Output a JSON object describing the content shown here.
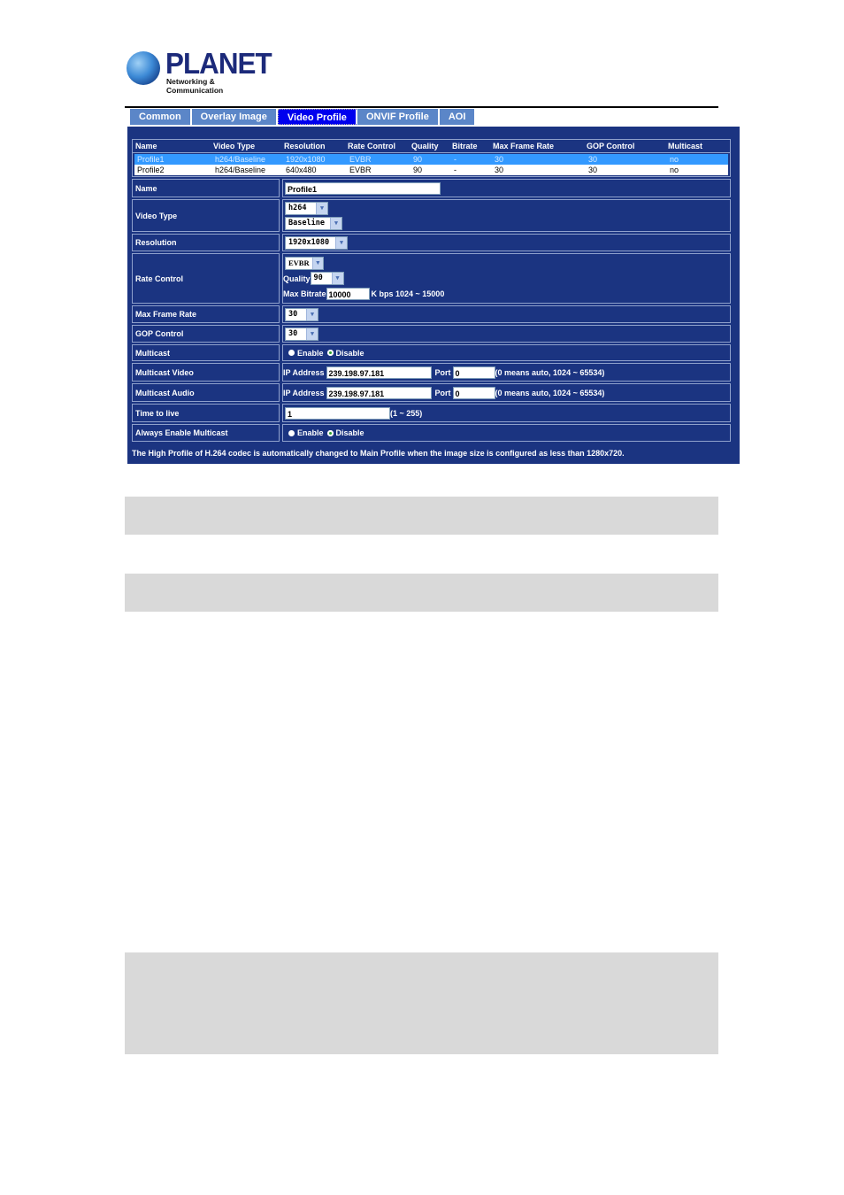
{
  "logo": {
    "brand": "PLANET",
    "tagline": "Networking & Communication"
  },
  "tabs": [
    {
      "label": "Common",
      "active": false
    },
    {
      "label": "Overlay Image",
      "active": false
    },
    {
      "label": "Video Profile",
      "active": true
    },
    {
      "label": "ONVIF Profile",
      "active": false
    },
    {
      "label": "AOI",
      "active": false
    }
  ],
  "profiles": {
    "headers": [
      "Name",
      "Video Type",
      "Resolution",
      "Rate Control",
      "Quality",
      "Bitrate",
      "Max Frame Rate",
      "GOP Control",
      "Multicast"
    ],
    "rows": [
      [
        "Profile1",
        "h264/Baseline",
        "1920x1080",
        "EVBR",
        "90",
        "-",
        "30",
        "30",
        "no"
      ],
      [
        "Profile2",
        "h264/Baseline",
        "640x480",
        "EVBR",
        "90",
        "-",
        "30",
        "30",
        "no"
      ]
    ],
    "selected_index": 0
  },
  "form": {
    "name": {
      "label": "Name",
      "value": "Profile1"
    },
    "video_type": {
      "label": "Video Type",
      "codec": "h264",
      "profile": "Baseline"
    },
    "resolution": {
      "label": "Resolution",
      "value": "1920x1080"
    },
    "rate_control": {
      "label": "Rate Control",
      "mode": "EVBR",
      "quality_label": "Quality",
      "quality": "90",
      "max_bitrate_label": "Max Bitrate",
      "max_bitrate": "10000",
      "bitrate_hint": "K bps 1024 ~ 15000"
    },
    "max_frame_rate": {
      "label": "Max Frame Rate",
      "value": "30"
    },
    "gop_control": {
      "label": "GOP Control",
      "value": "30"
    },
    "multicast": {
      "label": "Multicast",
      "enable_label": "Enable",
      "disable_label": "Disable",
      "selected": "Disable"
    },
    "multicast_video": {
      "label": "Multicast Video",
      "ip_label": "IP Address",
      "ip": "239.198.97.181",
      "port_label": "Port",
      "port": "0",
      "port_hint": "(0 means auto, 1024 ~ 65534)"
    },
    "multicast_audio": {
      "label": "Multicast Audio",
      "ip_label": "IP Address",
      "ip": "239.198.97.181",
      "port_label": "Port",
      "port": "0",
      "port_hint": "(0 means auto, 1024 ~ 65534)"
    },
    "ttl": {
      "label": "Time to live",
      "value": "1",
      "hint": "(1 ~ 255)"
    },
    "always_multicast": {
      "label": "Always Enable Multicast",
      "enable_label": "Enable",
      "disable_label": "Disable",
      "selected": "Disable"
    }
  },
  "note": "The High Profile of H.264 codec is automatically changed to Main Profile when the image size is configured as less than 1280x720.",
  "colors": {
    "panel_bg": "#1b3481",
    "tab_bg": "#5b86c8",
    "tab_active_bg": "#0000ee",
    "selected_row": "#3399ff",
    "gray_box": "#d9d9d9"
  }
}
